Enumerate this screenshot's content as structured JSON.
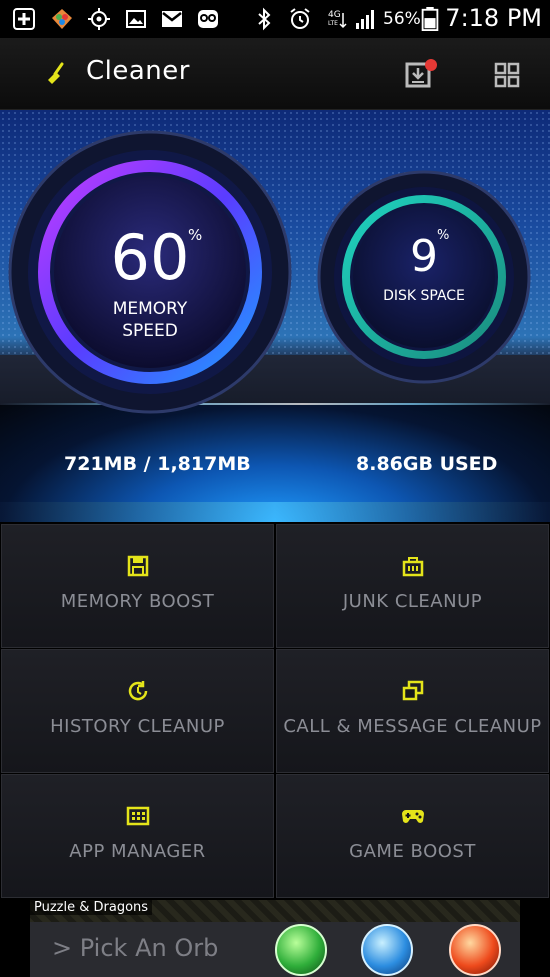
{
  "status_bar": {
    "battery_percent": "56%",
    "time": "7:18 PM",
    "network": "4G LTE",
    "icons": [
      "add-icon",
      "photos-icon",
      "gps-icon",
      "gallery-icon",
      "gmail-icon",
      "owl-icon",
      "bluetooth-icon",
      "alarm-icon",
      "lte-icon",
      "signal-icon",
      "battery-icon"
    ]
  },
  "app_bar": {
    "title": "Cleaner",
    "logo_icon": "broom-icon",
    "actions": [
      "download-icon",
      "grid-icon"
    ],
    "notification_dot_color": "#e53935"
  },
  "gauges": {
    "memory": {
      "value": "60",
      "unit": "%",
      "label_line1": "MEMORY",
      "label_line2": "SPEED",
      "percent": 60
    },
    "disk": {
      "value": "9",
      "unit": "%",
      "label": "DISK SPACE",
      "percent": 9
    }
  },
  "stats": {
    "memory": "721MB / 1,817MB",
    "disk": "8.86GB USED"
  },
  "menu": [
    {
      "label": "MEMORY BOOST",
      "icon": "save-icon"
    },
    {
      "label": "JUNK CLEANUP",
      "icon": "bin-icon"
    },
    {
      "label": "HISTORY CLEANUP",
      "icon": "history-icon"
    },
    {
      "label": "CALL & MESSAGE CLEANUP",
      "icon": "messages-icon"
    },
    {
      "label": "APP MANAGER",
      "icon": "apps-icon"
    },
    {
      "label": "GAME BOOST",
      "icon": "gamepad-icon"
    }
  ],
  "ad": {
    "title": "Puzzle & Dragons",
    "cta": "> Pick An Orb",
    "orbs": [
      "green-orb-icon",
      "blue-orb-icon",
      "red-orb-icon"
    ]
  },
  "colors": {
    "accent": "#e4e41a",
    "label_gray": "#8b8d95",
    "memory_ring": "#7a3cff",
    "disk_ring": "#1fd3c0"
  }
}
